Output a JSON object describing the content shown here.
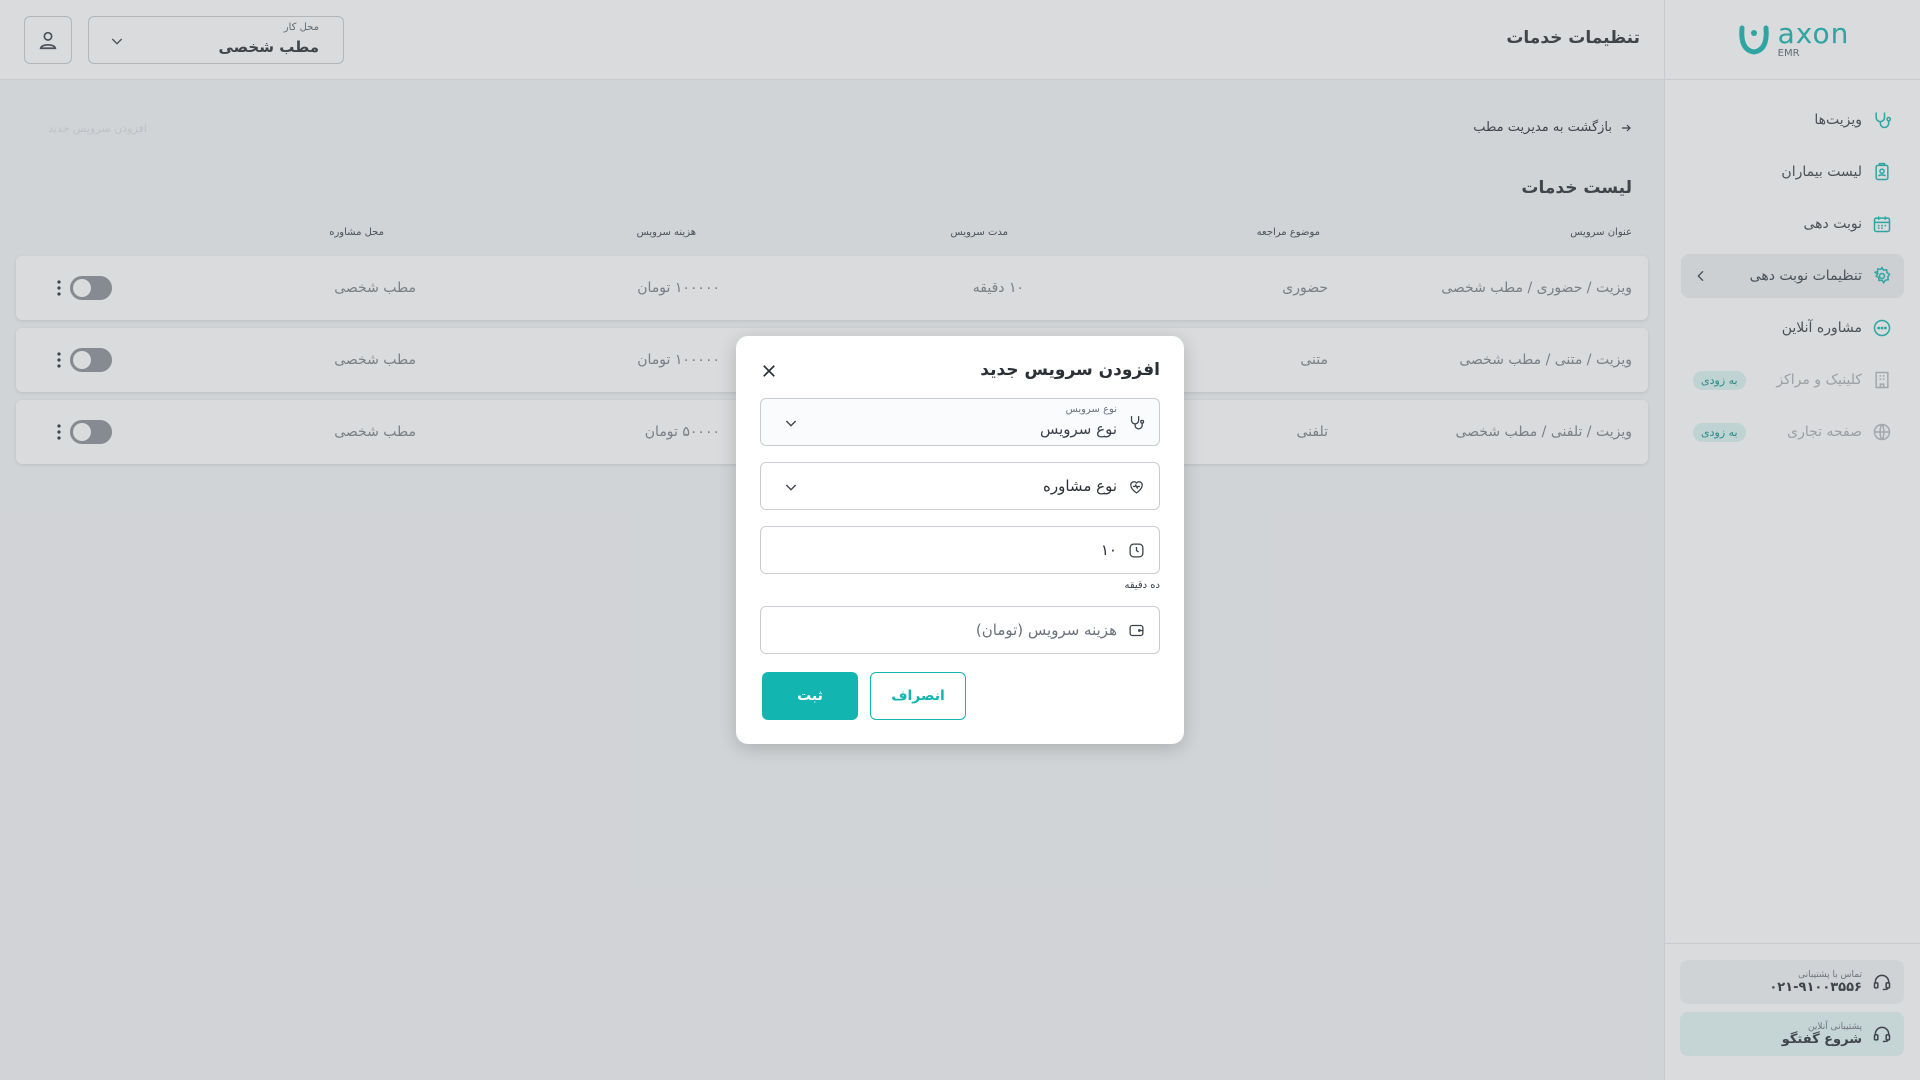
{
  "brand": {
    "name": "axon",
    "sub": "EMR",
    "color": "#13b5b1"
  },
  "sidebar": {
    "items": [
      {
        "label": "ویزیت‌ها",
        "icon": "stethoscope-icon"
      },
      {
        "label": "لیست بیماران",
        "icon": "patient-file-icon"
      },
      {
        "label": "نوبت دهی",
        "icon": "calendar-icon"
      },
      {
        "label": "تنظیمات نوبت دهی",
        "icon": "gear-icon"
      },
      {
        "label": "مشاوره آنلاین",
        "icon": "chat-bubble-icon"
      },
      {
        "label": "کلینیک و مراکز",
        "icon": "building-icon",
        "badge": "به زودی"
      },
      {
        "label": "صفحه تجاری",
        "icon": "globe-icon",
        "badge": "به زودی"
      }
    ],
    "support": {
      "phone_label": "تماس با پشتیبانی",
      "phone": "۰۲۱-۹۱۰۰۳۵۵۶",
      "chat_label": "پشتیبانی آنلاین",
      "chat_action": "شروع گفتگو"
    }
  },
  "topbar": {
    "title": "تنظیمات خدمات",
    "workplace_label": "محل کار",
    "workplace_value": "مطب شخصی"
  },
  "main": {
    "back_link": "بازگشت به مدیریت مطب",
    "ghost_action": "افزودن سرویس جدید",
    "section_title": "لیست خدمات",
    "columns": [
      "عنوان سرویس",
      "موضوع مراجعه",
      "مدت سرویس",
      "هزینه سرویس",
      "محل مشاوره"
    ],
    "rows": [
      {
        "title": "ویزیت / حضوری / مطب شخصی",
        "topic": "حضوری",
        "duration": "۱۰ دقیقه",
        "price": "۱۰۰۰۰۰ تومان",
        "location": "مطب شخصی"
      },
      {
        "title": "ویزیت / متنی / مطب شخصی",
        "topic": "متنی",
        "duration": "",
        "price": "۱۰۰۰۰۰ تومان",
        "location": "مطب شخصی"
      },
      {
        "title": "ویزیت / تلفنی / مطب شخصی",
        "topic": "تلفنی",
        "duration": "",
        "price": "۵۰۰۰۰ تومان",
        "location": "مطب شخصی"
      }
    ]
  },
  "modal": {
    "title": "افزودن سرویس جدید",
    "service_type_label": "نوع سرویس",
    "service_type_value": "نوع سرویس",
    "consult_type_value": "نوع مشاوره",
    "duration_value": "۱۰",
    "duration_helper": "ده دقیقه",
    "price_placeholder": "هزینه سرویس (تومان)",
    "submit": "ثبت",
    "cancel": "انصراف"
  }
}
